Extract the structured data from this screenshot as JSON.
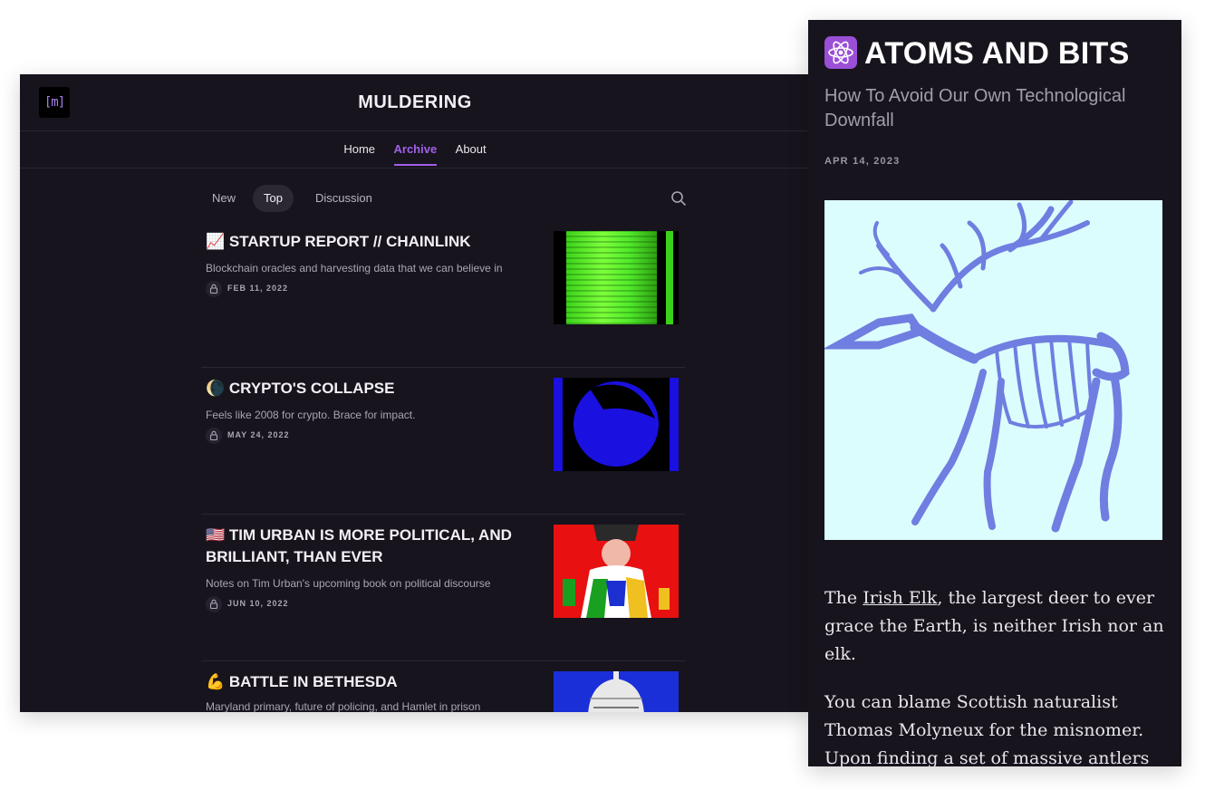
{
  "left": {
    "logo_text": "[m]",
    "site_title": "MULDERING",
    "nav": [
      "Home",
      "Archive",
      "About"
    ],
    "nav_active": "Archive",
    "tabs": [
      "New",
      "Top",
      "Discussion"
    ],
    "tab_active": "Top",
    "posts": [
      {
        "emoji": "📈",
        "title": "STARTUP REPORT // CHAINLINK",
        "subtitle": "Blockchain oracles and harvesting data that we can believe in",
        "date": "FEB 11, 2022"
      },
      {
        "emoji": "🌘",
        "title": "CRYPTO'S COLLAPSE",
        "subtitle": "Feels like 2008 for crypto. Brace for impact.",
        "date": "MAY 24, 2022"
      },
      {
        "emoji": "🇺🇸",
        "title": "TIM URBAN IS MORE POLITICAL, AND BRILLIANT, THAN EVER",
        "subtitle": "Notes on Tim Urban's upcoming book on political discourse",
        "date": "JUN 10, 2022"
      },
      {
        "emoji": "💪",
        "title": "BATTLE IN BETHESDA",
        "subtitle": "Maryland primary, future of policing, and Hamlet in prison",
        "date": ""
      }
    ]
  },
  "right": {
    "brand_icon": "atom-icon",
    "brand_title": "ATOMS AND BITS",
    "subtitle": "How To Avoid Our Own Technological Downfall",
    "date": "APR 14, 2023",
    "image": "irish-elk-skeleton",
    "para1_pre": "The ",
    "para1_link": "Irish Elk",
    "para1_post": ", the largest deer to ever grace the Earth, is neither Irish nor an elk.",
    "para2": "You can blame Scottish naturalist Thomas Molyneux for the misnomer. Upon finding a set of massive antlers"
  },
  "colors": {
    "background": "#17141d",
    "accent": "#a160ea",
    "text": "#f2f0f5",
    "muted": "#a9a5b3"
  }
}
